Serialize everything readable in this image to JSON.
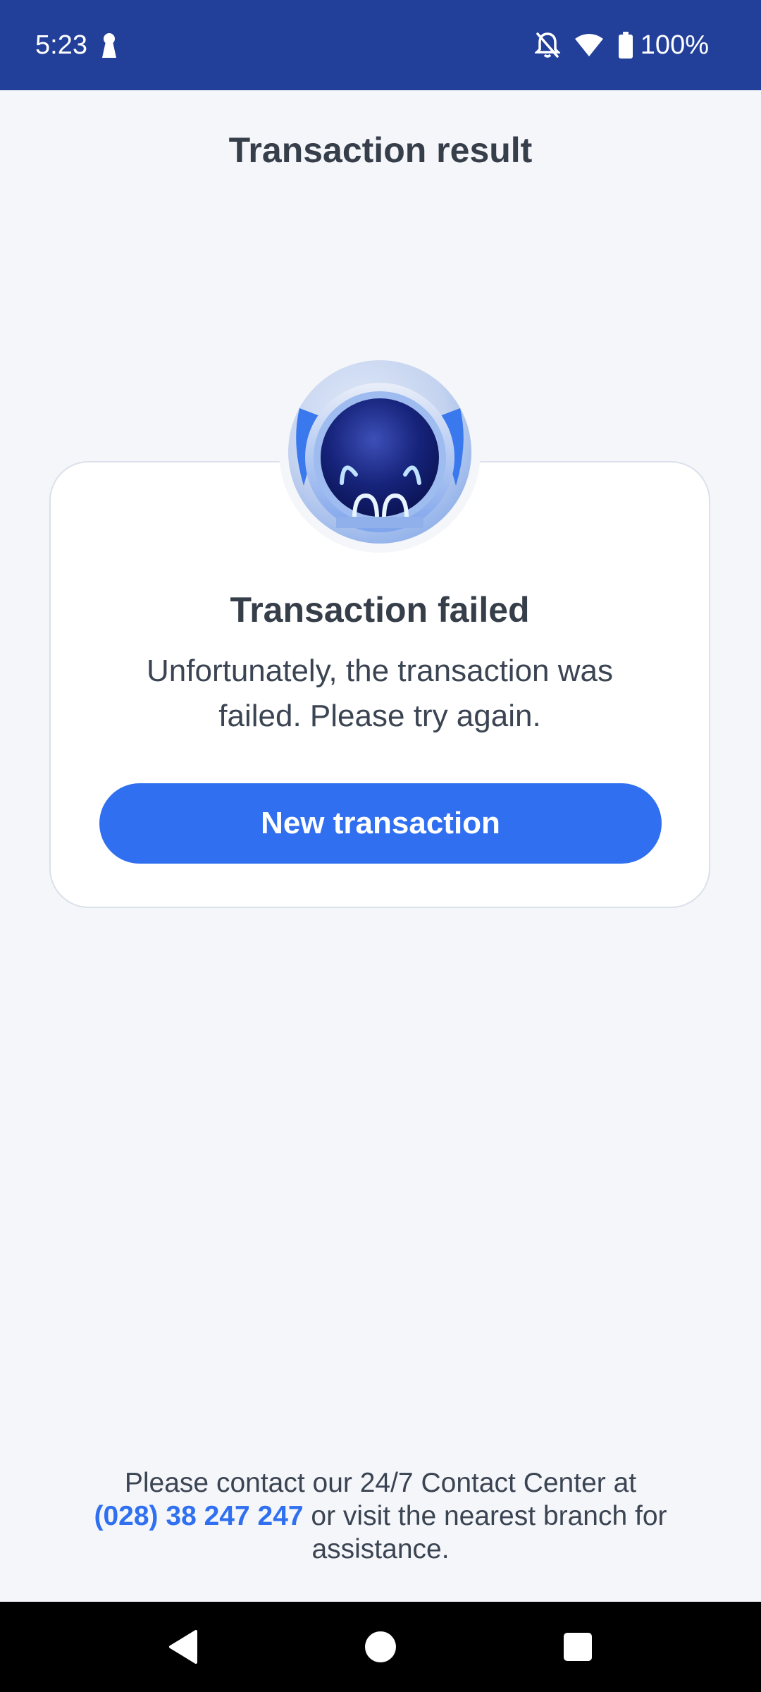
{
  "status_bar": {
    "time": "5:23",
    "battery": "100%",
    "icons": [
      "keyhole-icon",
      "bell-off-icon",
      "wifi-icon",
      "battery-icon"
    ]
  },
  "header": {
    "title": "Transaction result"
  },
  "card": {
    "mascot": "mascot-robot-icon",
    "title": "Transaction failed",
    "message": "Unfortunately, the transaction was failed. Please try again.",
    "button_label": "New transaction"
  },
  "footer": {
    "text_before": "Please contact our 24/7 Contact Center at",
    "phone": "(028) 38 247 247",
    "text_after": "or visit the nearest branch for assistance."
  },
  "nav_bar": {
    "icons": [
      "back-icon",
      "home-icon",
      "recents-icon"
    ]
  },
  "colors": {
    "status_bar_bg": "#22409a",
    "page_bg": "#f4f6fa",
    "accent": "#2f6ff0",
    "text": "#363e4a"
  }
}
